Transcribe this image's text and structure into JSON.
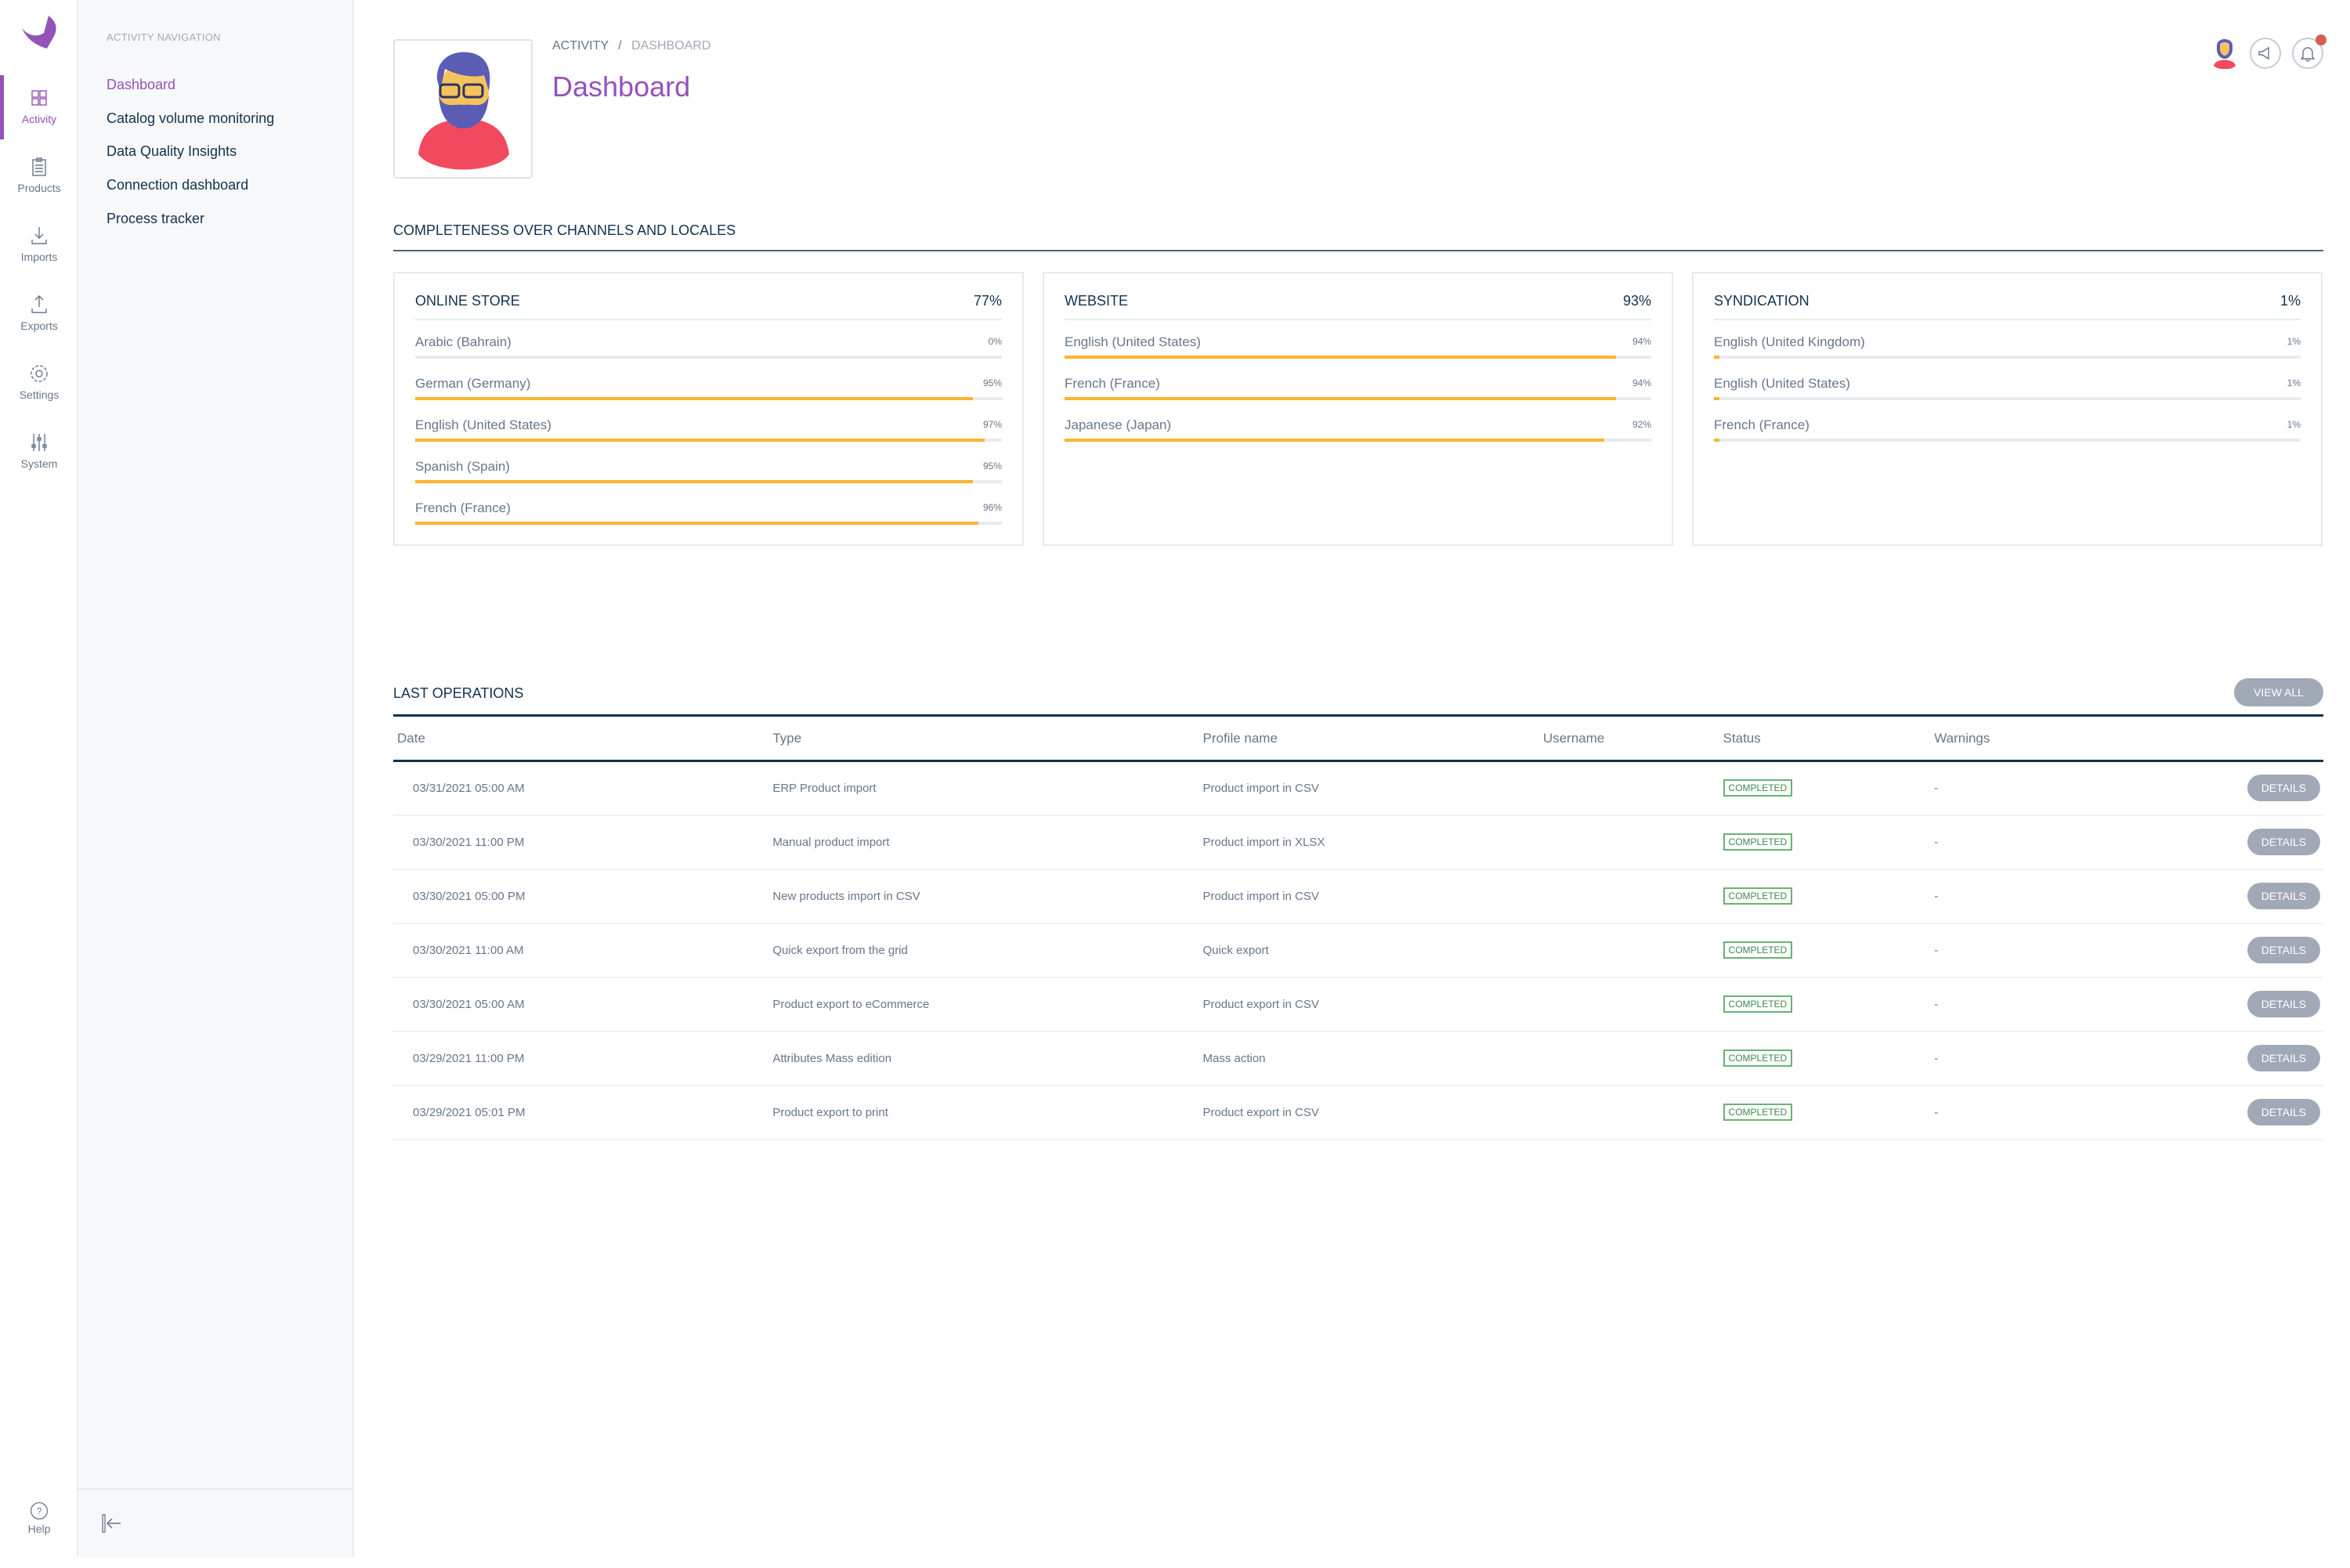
{
  "rail": {
    "items": [
      {
        "label": "Activity",
        "icon": "grid-icon",
        "active": true
      },
      {
        "label": "Products",
        "icon": "clipboard-icon"
      },
      {
        "label": "Imports",
        "icon": "import-icon"
      },
      {
        "label": "Exports",
        "icon": "export-icon"
      },
      {
        "label": "Settings",
        "icon": "gear-icon"
      },
      {
        "label": "System",
        "icon": "sliders-icon"
      }
    ],
    "help_label": "Help"
  },
  "nav": {
    "title": "ACTIVITY NAVIGATION",
    "items": [
      {
        "label": "Dashboard",
        "active": true
      },
      {
        "label": "Catalog volume monitoring"
      },
      {
        "label": "Data Quality Insights"
      },
      {
        "label": "Connection dashboard"
      },
      {
        "label": "Process tracker"
      }
    ]
  },
  "header": {
    "breadcrumb": [
      "ACTIVITY",
      "DASHBOARD"
    ],
    "separator": "/",
    "title": "Dashboard"
  },
  "completeness": {
    "title": "COMPLETENESS OVER CHANNELS AND LOCALES",
    "bar_color": "#ffb330",
    "channels": [
      {
        "name": "ONLINE STORE",
        "percent": "77%",
        "locales": [
          {
            "name": "Arabic (Bahrain)",
            "percent": "0%",
            "value": 0
          },
          {
            "name": "German (Germany)",
            "percent": "95%",
            "value": 95
          },
          {
            "name": "English (United States)",
            "percent": "97%",
            "value": 97
          },
          {
            "name": "Spanish (Spain)",
            "percent": "95%",
            "value": 95
          },
          {
            "name": "French (France)",
            "percent": "96%",
            "value": 96
          }
        ]
      },
      {
        "name": "WEBSITE",
        "percent": "93%",
        "locales": [
          {
            "name": "English (United States)",
            "percent": "94%",
            "value": 94
          },
          {
            "name": "French (France)",
            "percent": "94%",
            "value": 94
          },
          {
            "name": "Japanese (Japan)",
            "percent": "92%",
            "value": 92
          }
        ]
      },
      {
        "name": "SYNDICATION",
        "percent": "1%",
        "locales": [
          {
            "name": "English (United Kingdom)",
            "percent": "1%",
            "value": 1
          },
          {
            "name": "English (United States)",
            "percent": "1%",
            "value": 1
          },
          {
            "name": "French (France)",
            "percent": "1%",
            "value": 1
          }
        ]
      }
    ]
  },
  "operations": {
    "title": "LAST OPERATIONS",
    "view_all": "VIEW ALL",
    "columns": [
      "Date",
      "Type",
      "Profile name",
      "Username",
      "Status",
      "Warnings"
    ],
    "details_label": "DETAILS",
    "rows": [
      {
        "date": "03/31/2021 05:00 AM",
        "type": "ERP Product import",
        "profile": "Product import in CSV",
        "username": "",
        "status": "COMPLETED",
        "warnings": "-"
      },
      {
        "date": "03/30/2021 11:00 PM",
        "type": "Manual product import",
        "profile": "Product import in XLSX",
        "username": "",
        "status": "COMPLETED",
        "warnings": "-"
      },
      {
        "date": "03/30/2021 05:00 PM",
        "type": "New products import in CSV",
        "profile": "Product import in CSV",
        "username": "",
        "status": "COMPLETED",
        "warnings": "-"
      },
      {
        "date": "03/30/2021 11:00 AM",
        "type": "Quick export from the grid",
        "profile": "Quick export",
        "username": "",
        "status": "COMPLETED",
        "warnings": "-"
      },
      {
        "date": "03/30/2021 05:00 AM",
        "type": "Product export to eCommerce",
        "profile": "Product export in CSV",
        "username": "",
        "status": "COMPLETED",
        "warnings": "-"
      },
      {
        "date": "03/29/2021 11:00 PM",
        "type": "Attributes Mass edition",
        "profile": "Mass action",
        "username": "",
        "status": "COMPLETED",
        "warnings": "-"
      },
      {
        "date": "03/29/2021 05:01 PM",
        "type": "Product export to print",
        "profile": "Product export in CSV",
        "username": "",
        "status": "COMPLETED",
        "warnings": "-"
      }
    ]
  },
  "colors": {
    "accent": "#9452ba",
    "text": "#11324d",
    "muted": "#67768a",
    "success": "#67b373",
    "notification": "#d4604f"
  }
}
